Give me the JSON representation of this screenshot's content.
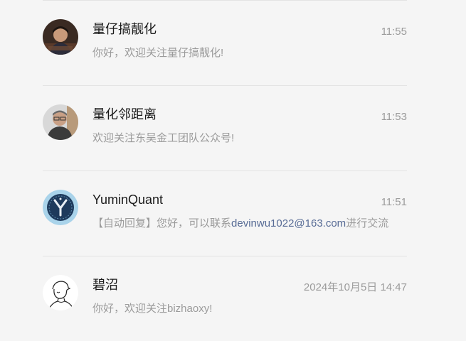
{
  "conversations": [
    {
      "name": "量仔搞靓化",
      "time": "11:55",
      "preview": "你好，欢迎关注量仔搞靓化!",
      "avatar_icon": "boy-portrait-avatar"
    },
    {
      "name": "量化邻距离",
      "time": "11:53",
      "preview": "欢迎关注东吴金工团队公众号!",
      "avatar_icon": "man-with-glasses-avatar"
    },
    {
      "name": "YuminQuant",
      "time": "11:51",
      "preview_prefix": "【自动回复】您好，可以联系",
      "preview_email": "devinwu1022@163.com",
      "preview_suffix": "进行交流",
      "avatar_icon": "y-logo-avatar"
    },
    {
      "name": "碧沼",
      "time": "2024年10月5日 14:47",
      "preview": "你好，欢迎关注bizhaoxy!",
      "avatar_icon": "sketch-person-avatar"
    }
  ],
  "colors": {
    "background": "#f5f5f5",
    "name_text": "#1a1a1a",
    "muted_text": "#9b9b9b",
    "link_text": "#576b95",
    "separator": "#e3e3e3"
  }
}
